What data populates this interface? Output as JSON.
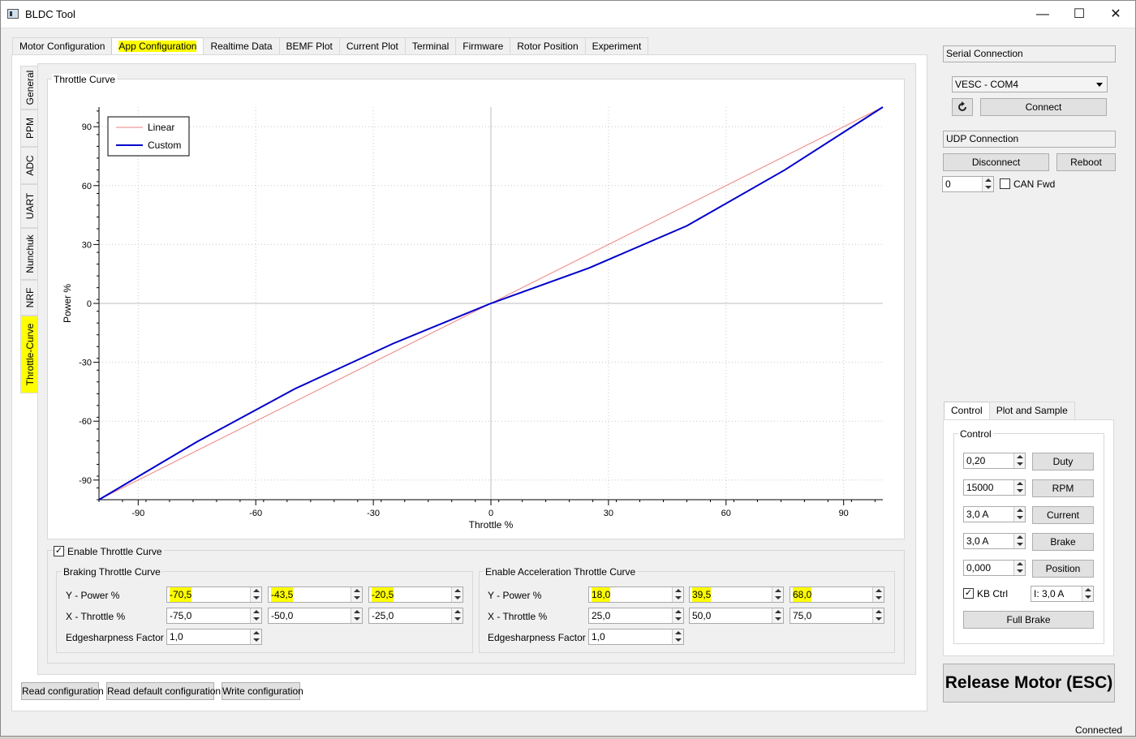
{
  "window": {
    "title": "BLDC Tool",
    "minimize": "—",
    "maximize": "☐",
    "close": "✕"
  },
  "tabs": [
    {
      "label": "Motor Configuration"
    },
    {
      "label": "App Configuration",
      "active": true,
      "highlighted": true
    },
    {
      "label": "Realtime Data"
    },
    {
      "label": "BEMF Plot"
    },
    {
      "label": "Current Plot"
    },
    {
      "label": "Terminal"
    },
    {
      "label": "Firmware"
    },
    {
      "label": "Rotor Position"
    },
    {
      "label": "Experiment"
    }
  ],
  "side_tabs": [
    {
      "label": "General"
    },
    {
      "label": "PPM"
    },
    {
      "label": "ADC"
    },
    {
      "label": "UART"
    },
    {
      "label": "Nunchuk"
    },
    {
      "label": "NRF"
    },
    {
      "label": "Throttle-Curve",
      "active": true,
      "highlighted": true
    }
  ],
  "throttle_curve": {
    "group_title": "Throttle Curve",
    "enable_label": "Enable Throttle Curve",
    "enable_checked": true,
    "braking": {
      "title": "Braking Throttle Curve",
      "y_label": "Y - Power %",
      "x_label": "X - Throttle %",
      "edge_label": "Edgesharpness Factor",
      "y_values": [
        "-70,5",
        "-43,5",
        "-20,5"
      ],
      "x_values": [
        "-75,0",
        "-50,0",
        "-25,0"
      ],
      "edge_value": "1,0"
    },
    "accel": {
      "title": "Enable Acceleration Throttle Curve",
      "y_label": "Y - Power %",
      "x_label": "X - Throttle %",
      "edge_label": "Edgesharpness Factor",
      "y_values": [
        "18,0",
        "39,5",
        "68,0"
      ],
      "x_values": [
        "25,0",
        "50,0",
        "75,0"
      ],
      "edge_value": "1,0"
    }
  },
  "chart_data": {
    "type": "line",
    "title": "",
    "xlabel": "Throttle %",
    "ylabel": "Power %",
    "xlim": [
      -100,
      100
    ],
    "ylim": [
      -100,
      100
    ],
    "xticks": [
      -90,
      -60,
      -30,
      0,
      30,
      60,
      90
    ],
    "yticks": [
      90,
      60,
      30,
      0,
      -30,
      -60,
      -90
    ],
    "grid": true,
    "legend_position": "top-left",
    "series": [
      {
        "name": "Linear",
        "color": "#f08080",
        "x": [
          -100,
          100
        ],
        "y": [
          -100,
          100
        ]
      },
      {
        "name": "Custom",
        "color": "#0000cc",
        "x": [
          -100,
          -75,
          -50,
          -25,
          0,
          25,
          50,
          75,
          100
        ],
        "y": [
          -100,
          -70.5,
          -43.5,
          -20.5,
          0,
          18,
          39.5,
          68,
          100
        ]
      }
    ]
  },
  "bottom_buttons": [
    "Read configuration",
    "Read default configuration",
    "Write configuration"
  ],
  "serial": {
    "header": "Serial Connection",
    "port": "VESC - COM4",
    "refresh_icon": "refresh-icon",
    "connect": "Connect"
  },
  "udp": {
    "header": "UDP Connection",
    "disconnect": "Disconnect",
    "reboot": "Reboot",
    "can_id": "0",
    "can_fwd_label": "CAN Fwd",
    "can_fwd_checked": false
  },
  "control_tabs": [
    {
      "label": "Control",
      "active": true
    },
    {
      "label": "Plot and Sample"
    }
  ],
  "control": {
    "group_title": "Control",
    "rows": [
      {
        "value": "0,20",
        "button": "Duty"
      },
      {
        "value": "15000",
        "button": "RPM"
      },
      {
        "value": "3,0 A",
        "button": "Current"
      },
      {
        "value": "3,0 A",
        "button": "Brake"
      },
      {
        "value": "0,000",
        "button": "Position"
      }
    ],
    "kb_ctrl_label": "KB Ctrl",
    "kb_ctrl_checked": true,
    "kb_current": "I: 3,0 A",
    "full_brake": "Full Brake"
  },
  "release_button": "Release Motor (ESC)",
  "status": "Connected"
}
